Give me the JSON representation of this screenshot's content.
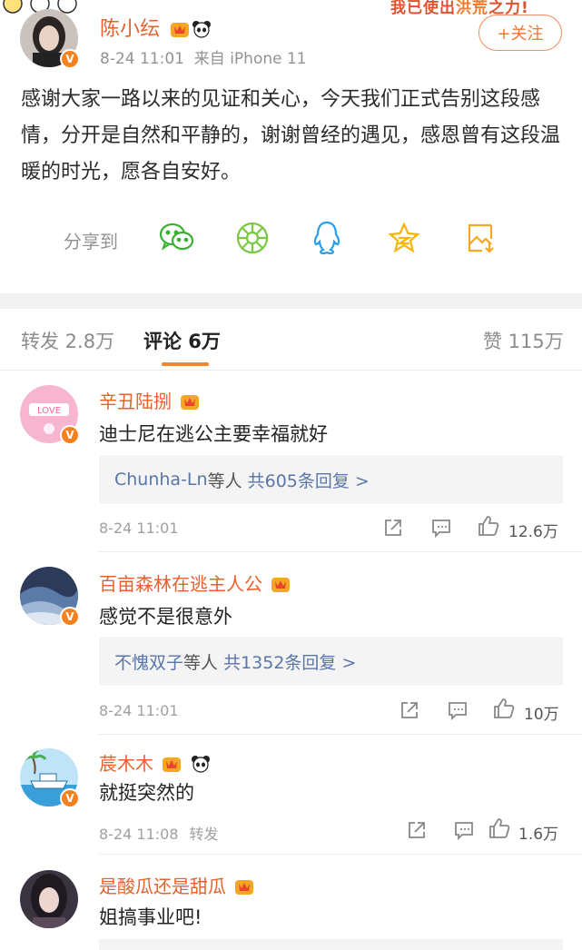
{
  "banner": {
    "prefix": "我已使出",
    "highlight": "洪荒",
    "suffix": "之力!"
  },
  "post": {
    "author": "陈小纭",
    "time": "8-24 11:01",
    "source": "来自 iPhone 11",
    "follow_label": "+关注",
    "body": "感谢大家一路以来的见证和关心，今天我们正式告别这段感情，分开是自然和平静的，谢谢曾经的遇见，感恩曾有这段温暖的时光，愿各自安好。"
  },
  "share": {
    "label": "分享到",
    "targets": [
      "wechat-icon",
      "moments-icon",
      "qq-icon",
      "qzone-icon",
      "save-image-icon"
    ],
    "colors": {
      "wechat": "#3cb034",
      "moments": "#7ac943",
      "qq": "#2a9ee8",
      "qzone": "#f5b400",
      "save": "#f5a623"
    }
  },
  "tabs": {
    "repost": "转发 2.8万",
    "comment": "评论 6万",
    "like": "赞 115万"
  },
  "accent": "#f5852c",
  "comments": [
    {
      "user": "辛丑陆捌",
      "text": "迪士尼在逃公主要幸福就好",
      "reply_names": "Chunha-Ln",
      "reply_mid": "等人",
      "reply_count": "共605条回复 >",
      "time": "8-24 11:01",
      "likes": "12.6万"
    },
    {
      "user": "百亩森林在逃主人公",
      "text": "感觉不是很意外",
      "reply_names": "不愧双子",
      "reply_mid": "等人",
      "reply_count": "共1352条回复 >",
      "time": "8-24 11:01",
      "likes": "10万"
    },
    {
      "user": "莀木木",
      "text": "就挺突然的",
      "time": "8-24 11:08",
      "repost_label": "转发",
      "likes": "1.6万"
    },
    {
      "user": "是酸瓜还是甜瓜",
      "text": "姐搞事业吧!"
    }
  ]
}
